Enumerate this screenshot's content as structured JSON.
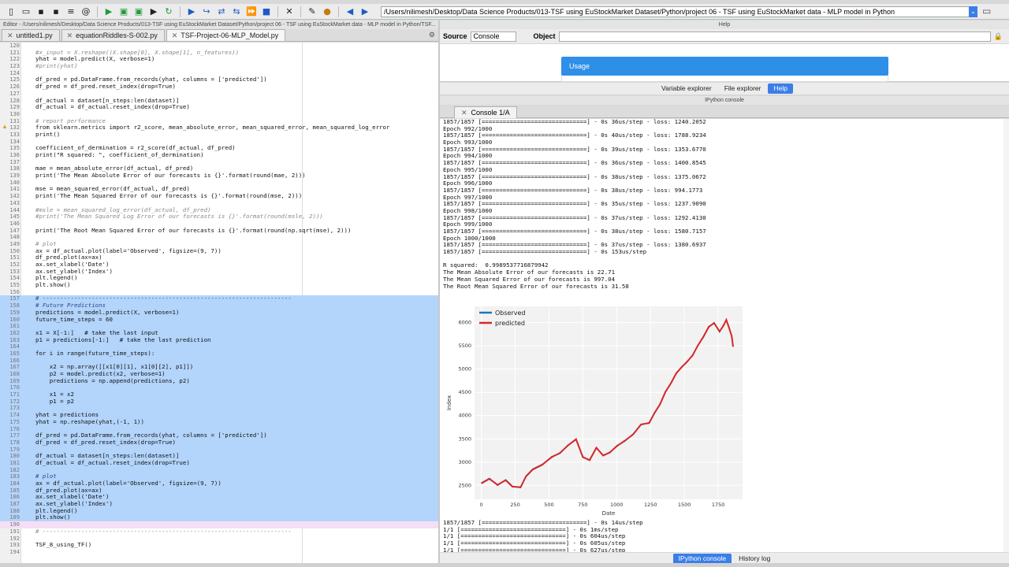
{
  "toolbar": {
    "path": "/Users/nilimesh/Desktop/Data Science Products/013-TSF using EuStockMarket Dataset/Python/project 06 - TSF using EuStockMarket data - MLP model in Python",
    "icons": [
      "new-file",
      "open-file",
      "save",
      "save-all",
      "list",
      "at",
      "run-file",
      "run-cell",
      "run-cell-advance",
      "run-selection",
      "re-run",
      "debug",
      "step",
      "step-into",
      "step-out",
      "continue",
      "stop",
      "maximize",
      "preferences",
      "python-path",
      "back",
      "forward"
    ]
  },
  "editor": {
    "title": "Editor - /Users/nilimesh/Desktop/Data Science Products/013-TSF using EuStockMarket Dataset/Python/project 06 - TSF using EuStockMarket data - MLP model in Python/TSF...",
    "tabs": [
      {
        "label": "untitled1.py"
      },
      {
        "label": "equationRiddles-S-002.py"
      },
      {
        "label": "TSF-Project-06-MLP_Model.py"
      }
    ],
    "lines": [
      {
        "n": "120",
        "t": "",
        "k": ""
      },
      {
        "n": "121",
        "t": "#x_input = X.reshape((X.shape[0], X.shape[1], n_features))",
        "k": "comment"
      },
      {
        "n": "122",
        "t": "yhat = model.predict(X, verbose=1)",
        "k": ""
      },
      {
        "n": "123",
        "t": "#print(yhat)",
        "k": "comment"
      },
      {
        "n": "124",
        "t": "",
        "k": ""
      },
      {
        "n": "125",
        "t": "df_pred = pd.DataFrame.from_records(yhat, columns = ['predicted'])",
        "k": ""
      },
      {
        "n": "126",
        "t": "df_pred = df_pred.reset_index(drop=True)",
        "k": ""
      },
      {
        "n": "127",
        "t": "",
        "k": ""
      },
      {
        "n": "128",
        "t": "df_actual = dataset[n_steps:len(dataset)]",
        "k": ""
      },
      {
        "n": "129",
        "t": "df_actual = df_actual.reset_index(drop=True)",
        "k": ""
      },
      {
        "n": "130",
        "t": "",
        "k": ""
      },
      {
        "n": "131",
        "t": "# report performance",
        "k": "comment"
      },
      {
        "n": "132",
        "t": "from sklearn.metrics import r2_score, mean_absolute_error, mean_squared_error, mean_squared_log_error",
        "k": ""
      },
      {
        "n": "133",
        "t": "print()",
        "k": ""
      },
      {
        "n": "134",
        "t": "",
        "k": ""
      },
      {
        "n": "135",
        "t": "coefficient_of_dermination = r2_score(df_actual, df_pred)",
        "k": ""
      },
      {
        "n": "136",
        "t": "print(\"R squared: \", coefficient_of_dermination)",
        "k": ""
      },
      {
        "n": "137",
        "t": "",
        "k": ""
      },
      {
        "n": "138",
        "t": "mae = mean_absolute_error(df_actual, df_pred)",
        "k": ""
      },
      {
        "n": "139",
        "t": "print('The Mean Absolute Error of our forecasts is {}'.format(round(mae, 2)))",
        "k": ""
      },
      {
        "n": "140",
        "t": "",
        "k": ""
      },
      {
        "n": "141",
        "t": "mse = mean_squared_error(df_actual, df_pred)",
        "k": ""
      },
      {
        "n": "142",
        "t": "print('The Mean Squared Error of our forecasts is {}'.format(round(mse, 2)))",
        "k": ""
      },
      {
        "n": "143",
        "t": "",
        "k": ""
      },
      {
        "n": "144",
        "t": "#msle = mean_squared_log_error(df_actual, df_pred)",
        "k": "comment"
      },
      {
        "n": "145",
        "t": "#print('The Mean Squared Log Error of our forecasts is {}'.format(round(msle, 2)))",
        "k": "comment"
      },
      {
        "n": "146",
        "t": "",
        "k": ""
      },
      {
        "n": "147",
        "t": "print('The Root Mean Squared Error of our forecasts is {}'.format(round(np.sqrt(mse), 2)))",
        "k": ""
      },
      {
        "n": "148",
        "t": "",
        "k": ""
      },
      {
        "n": "149",
        "t": "# plot",
        "k": "comment"
      },
      {
        "n": "150",
        "t": "ax = df_actual.plot(label='Observed', figsize=(9, 7))",
        "k": ""
      },
      {
        "n": "151",
        "t": "df_pred.plot(ax=ax)",
        "k": ""
      },
      {
        "n": "152",
        "t": "ax.set_xlabel('Date')",
        "k": ""
      },
      {
        "n": "153",
        "t": "ax.set_ylabel('Index')",
        "k": ""
      },
      {
        "n": "154",
        "t": "plt.legend()",
        "k": ""
      },
      {
        "n": "155",
        "t": "plt.show()",
        "k": ""
      },
      {
        "n": "156",
        "t": "",
        "k": ""
      },
      {
        "n": "157",
        "t": "# -----------------------------------------------------------------------",
        "k": "selc"
      },
      {
        "n": "158",
        "t": "# Future Predictions",
        "k": "selc"
      },
      {
        "n": "159",
        "t": "predictions = model.predict(X, verbose=1)",
        "k": "sel"
      },
      {
        "n": "160",
        "t": "future_time_steps = 60",
        "k": "sel"
      },
      {
        "n": "161",
        "t": "",
        "k": "sel"
      },
      {
        "n": "162",
        "t": "x1 = X[-1:]   # take the last input",
        "k": "sel"
      },
      {
        "n": "163",
        "t": "p1 = predictions[-1:]   # take the last prediction",
        "k": "sel"
      },
      {
        "n": "164",
        "t": "",
        "k": "sel"
      },
      {
        "n": "165",
        "t": "for i in range(future_time_steps):",
        "k": "sel"
      },
      {
        "n": "166",
        "t": "",
        "k": "sel"
      },
      {
        "n": "167",
        "t": "    x2 = np.array([[x1[0][1], x1[0][2], p1]])",
        "k": "sel"
      },
      {
        "n": "168",
        "t": "    p2 = model.predict(x2, verbose=1)",
        "k": "sel"
      },
      {
        "n": "169",
        "t": "    predictions = np.append(predictions, p2)",
        "k": "sel"
      },
      {
        "n": "170",
        "t": "",
        "k": "sel"
      },
      {
        "n": "171",
        "t": "    x1 = x2",
        "k": "sel"
      },
      {
        "n": "172",
        "t": "    p1 = p2",
        "k": "sel"
      },
      {
        "n": "173",
        "t": "",
        "k": "sel"
      },
      {
        "n": "174",
        "t": "yhat = predictions",
        "k": "sel"
      },
      {
        "n": "175",
        "t": "yhat = np.reshape(yhat,(-1, 1))",
        "k": "sel"
      },
      {
        "n": "176",
        "t": "",
        "k": "sel"
      },
      {
        "n": "177",
        "t": "df_pred = pd.DataFrame.from_records(yhat, columns = ['predicted'])",
        "k": "sel"
      },
      {
        "n": "178",
        "t": "df_pred = df_pred.reset_index(drop=True)",
        "k": "sel"
      },
      {
        "n": "179",
        "t": "",
        "k": "sel"
      },
      {
        "n": "180",
        "t": "df_actual = dataset[n_steps:len(dataset)]",
        "k": "sel"
      },
      {
        "n": "181",
        "t": "df_actual = df_actual.reset_index(drop=True)",
        "k": "sel"
      },
      {
        "n": "182",
        "t": "",
        "k": "sel"
      },
      {
        "n": "183",
        "t": "# plot",
        "k": "selc"
      },
      {
        "n": "184",
        "t": "ax = df_actual.plot(label='Observed', figsize=(9, 7))",
        "k": "sel"
      },
      {
        "n": "185",
        "t": "df_pred.plot(ax=ax)",
        "k": "sel"
      },
      {
        "n": "186",
        "t": "ax.set_xlabel('Date')",
        "k": "sel"
      },
      {
        "n": "187",
        "t": "ax.set_ylabel('Index')",
        "k": "sel"
      },
      {
        "n": "188",
        "t": "plt.legend()",
        "k": "sel"
      },
      {
        "n": "189",
        "t": "plt.show()",
        "k": "sel"
      },
      {
        "n": "190",
        "t": "",
        "k": "cur"
      },
      {
        "n": "191",
        "t": "# -----------------------------------------------------------------------",
        "k": "comment"
      },
      {
        "n": "192",
        "t": "",
        "k": ""
      },
      {
        "n": "193",
        "t": "TSF_8_using_TF()",
        "k": ""
      },
      {
        "n": "194",
        "t": "",
        "k": ""
      }
    ]
  },
  "help": {
    "title": "Help",
    "source_label": "Source",
    "source_value": "Console",
    "object_label": "Object",
    "usage": "Usage",
    "tabs": [
      {
        "label": "Variable explorer",
        "active": false
      },
      {
        "label": "File explorer",
        "active": false
      },
      {
        "label": "Help",
        "active": true
      }
    ]
  },
  "ipython": {
    "title": "IPython console",
    "tab": "Console 1/A",
    "lines": [
      "1857/1857 [==============================] - 0s 36us/step - loss: 1240.2052",
      "Epoch 992/1000",
      "1857/1857 [==============================] - 0s 40us/step - loss: 1788.9234",
      "Epoch 993/1000",
      "1857/1857 [==============================] - 0s 39us/step - loss: 1353.6770",
      "Epoch 994/1000",
      "1857/1857 [==============================] - 0s 36us/step - loss: 1400.8545",
      "Epoch 995/1000",
      "1857/1857 [==============================] - 0s 38us/step - loss: 1375.0672",
      "Epoch 996/1000",
      "1857/1857 [==============================] - 0s 38us/step - loss: 994.1773",
      "Epoch 997/1000",
      "1857/1857 [==============================] - 0s 35us/step - loss: 1237.9090",
      "Epoch 998/1000",
      "1857/1857 [==============================] - 0s 37us/step - loss: 1292.4130",
      "Epoch 999/1000",
      "1857/1857 [==============================] - 0s 38us/step - loss: 1580.7157",
      "Epoch 1000/1000",
      "1857/1857 [==============================] - 0s 37us/step - loss: 1380.6937",
      "1857/1857 [==============================] - 0s 153us/step",
      "",
      "R squared:  0.9989537716879942",
      "The Mean Absolute Error of our forecasts is 22.71",
      "The Mean Squared Error of our forecasts is 997.04",
      "The Root Mean Squared Error of our forecasts is 31.58"
    ],
    "after_lines": [
      "1857/1857 [==============================] - 0s 14us/step",
      "1/1 [==============================] - 0s 1ms/step",
      "1/1 [==============================] - 0s 604us/step",
      "1/1 [==============================] - 0s 605us/step",
      "1/1 [==============================] - 0s 627us/step"
    ],
    "bottom_tabs": [
      {
        "label": "IPython console",
        "active": true
      },
      {
        "label": "History log",
        "active": false
      }
    ]
  },
  "chart_data": {
    "type": "line",
    "title": "",
    "xlabel": "Date",
    "ylabel": "Index",
    "xlim": [
      -50,
      1930
    ],
    "ylim": [
      2200,
      6350
    ],
    "xticks": [
      0,
      250,
      500,
      750,
      1000,
      1250,
      1500,
      1750
    ],
    "yticks": [
      2500,
      3000,
      3500,
      4000,
      4500,
      5000,
      5500,
      6000
    ],
    "grid": true,
    "legend": "top-left",
    "colors": {
      "Observed": "#1f77b4",
      "predicted": "#d62728"
    },
    "series": [
      {
        "name": "Observed",
        "x": [
          0,
          60,
          120,
          180,
          230,
          290,
          330,
          380,
          450,
          520,
          580,
          640,
          700,
          750,
          800,
          850,
          900,
          950,
          1000,
          1060,
          1120,
          1180,
          1240,
          1280,
          1320,
          1360,
          1400,
          1440,
          1480,
          1520,
          1560,
          1600,
          1640,
          1680,
          1720,
          1760,
          1790,
          1810,
          1830,
          1850,
          1860
        ],
        "values": [
          2550,
          2650,
          2500,
          2620,
          2480,
          2450,
          2700,
          2850,
          2950,
          3100,
          3200,
          3350,
          3500,
          3100,
          3050,
          3300,
          3150,
          3200,
          3350,
          3450,
          3600,
          3800,
          3850,
          4050,
          4250,
          4500,
          4700,
          4900,
          5050,
          5150,
          5300,
          5500,
          5700,
          5900,
          6000,
          5800,
          5950,
          6050,
          5900,
          5700,
          5500
        ]
      },
      {
        "name": "predicted",
        "x": [
          0,
          60,
          120,
          180,
          230,
          290,
          330,
          380,
          450,
          520,
          580,
          640,
          700,
          750,
          800,
          850,
          900,
          950,
          1000,
          1060,
          1120,
          1180,
          1240,
          1280,
          1320,
          1360,
          1400,
          1440,
          1480,
          1520,
          1560,
          1600,
          1640,
          1680,
          1720,
          1760,
          1790,
          1810,
          1830,
          1850,
          1860
        ],
        "values": [
          2540,
          2640,
          2510,
          2610,
          2470,
          2460,
          2690,
          2840,
          2940,
          3110,
          3190,
          3360,
          3490,
          3110,
          3040,
          3310,
          3140,
          3210,
          3340,
          3460,
          3590,
          3810,
          3840,
          4060,
          4240,
          4510,
          4690,
          4910,
          5040,
          5160,
          5290,
          5510,
          5690,
          5910,
          5990,
          5810,
          5940,
          6060,
          5890,
          5710,
          5480
        ]
      }
    ]
  }
}
